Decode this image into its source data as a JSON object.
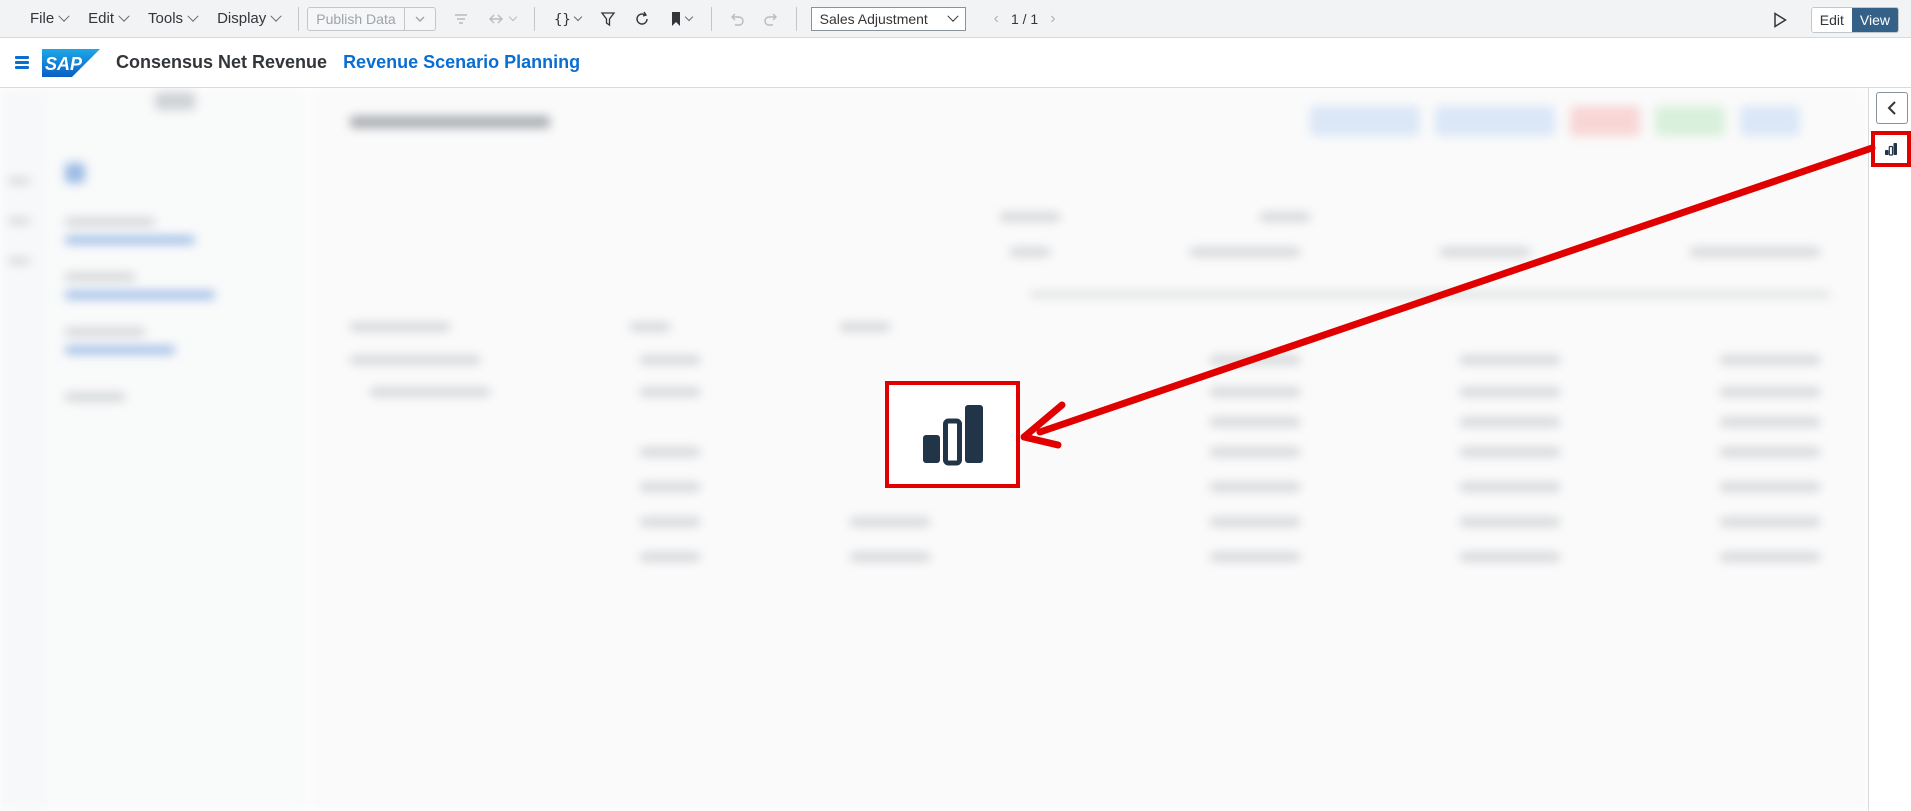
{
  "toolbar": {
    "menus": [
      {
        "label": "File"
      },
      {
        "label": "Edit"
      },
      {
        "label": "Tools"
      },
      {
        "label": "Display"
      }
    ],
    "publish_label": "Publish Data",
    "view_select": "Sales Adjustment",
    "pager": "1 / 1",
    "edit_label": "Edit",
    "view_label": "View"
  },
  "shell": {
    "logo_text": "SAP",
    "app_title": "Consensus Net Revenue",
    "story_title": "Revenue Scenario Planning"
  },
  "colors": {
    "accent": "#0a6ed1",
    "annotation": "#e00000",
    "view_active": "#346187"
  },
  "icons": {
    "rail_collapse": "chevron-left-icon",
    "rail_chart": "bar-chart-icon"
  }
}
